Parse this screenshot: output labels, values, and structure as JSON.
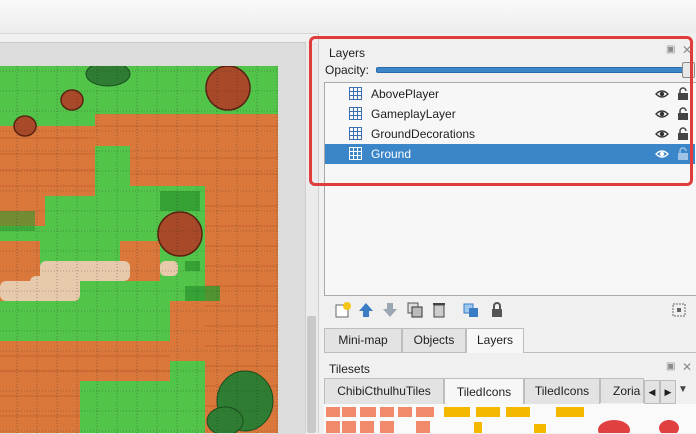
{
  "layers_panel": {
    "title": "Layers",
    "opacity_label": "Opacity:",
    "opacity_value": 1.0,
    "layers": [
      {
        "name": "AbovePlayer",
        "visible": true,
        "locked": false,
        "selected": false
      },
      {
        "name": "GameplayLayer",
        "visible": true,
        "locked": false,
        "selected": false
      },
      {
        "name": "GroundDecorations",
        "visible": true,
        "locked": false,
        "selected": false
      },
      {
        "name": "Ground",
        "visible": true,
        "locked": false,
        "selected": true
      }
    ],
    "toolbar_icons": [
      "new-layer-icon",
      "raise-layer-icon",
      "lower-layer-icon",
      "duplicate-layer-icon",
      "delete-layer-icon",
      "show-other-layers-icon",
      "lock-layer-icon"
    ],
    "tabs": [
      {
        "label": "Mini-map",
        "active": false
      },
      {
        "label": "Objects",
        "active": false
      },
      {
        "label": "Layers",
        "active": true
      }
    ]
  },
  "tilesets_panel": {
    "title": "Tilesets",
    "tabs": [
      {
        "label": "ChibiCthulhuTiles",
        "active": false
      },
      {
        "label": "TiledIcons",
        "active": true
      },
      {
        "label": "TiledIcons",
        "active": false
      },
      {
        "label": "Zoria",
        "active": false
      }
    ]
  },
  "colors": {
    "selection": "#3b86c9",
    "highlight_box": "#e03c3c",
    "grass": "#52c44a",
    "dirt": "#d9783a",
    "tree": "#a84a2a"
  }
}
